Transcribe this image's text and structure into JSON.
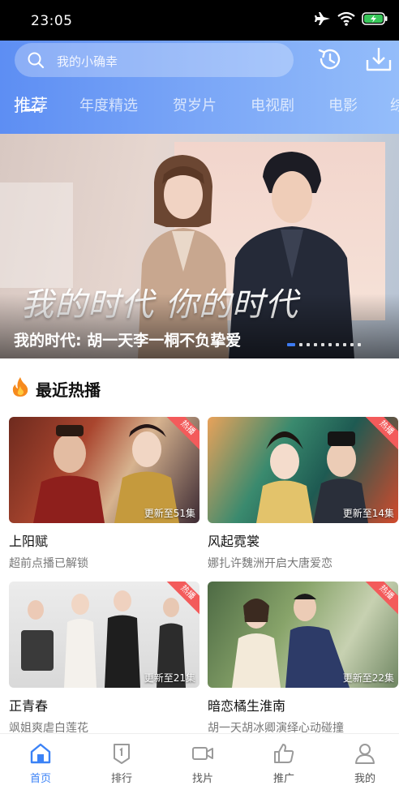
{
  "status_bar": {
    "time": "23:05"
  },
  "search": {
    "placeholder": "我的小确幸"
  },
  "tabs": [
    {
      "label": "推荐",
      "active": true
    },
    {
      "label": "年度精选"
    },
    {
      "label": "贺岁片"
    },
    {
      "label": "电视剧"
    },
    {
      "label": "电影"
    },
    {
      "label": "综"
    }
  ],
  "banner": {
    "calligraphy": "我的时代 你的时代",
    "caption": "我的时代: 胡一天李一桐不负挚爱",
    "page_count": 10,
    "active_page": 1
  },
  "section": {
    "title": "最近热播"
  },
  "cards": [
    {
      "title": "上阳赋",
      "subtitle": "超前点播已解锁",
      "update": "更新至51集",
      "badge": "热播"
    },
    {
      "title": "风起霓裳",
      "subtitle": "娜扎许魏洲开启大唐爱恋",
      "update": "更新至14集",
      "badge": "热播"
    },
    {
      "title": "正青春",
      "subtitle": "飒姐爽虐白莲花",
      "update": "更新至21集",
      "badge": "热播"
    },
    {
      "title": "暗恋橘生淮南",
      "subtitle": "胡一天胡冰卿演绎心动碰撞",
      "update": "更新至22集",
      "badge": "热播"
    }
  ],
  "bottom_nav": [
    {
      "label": "首页",
      "icon": "home-icon",
      "active": true
    },
    {
      "label": "排行",
      "icon": "ranking-icon"
    },
    {
      "label": "找片",
      "icon": "video-camera-icon"
    },
    {
      "label": "推广",
      "icon": "thumbs-up-icon"
    },
    {
      "label": "我的",
      "icon": "person-icon"
    }
  ],
  "colors": {
    "accent": "#3b82f6",
    "badge": "#f35b5b",
    "header_start": "#5d8ef3",
    "header_end": "#94bdfa"
  }
}
